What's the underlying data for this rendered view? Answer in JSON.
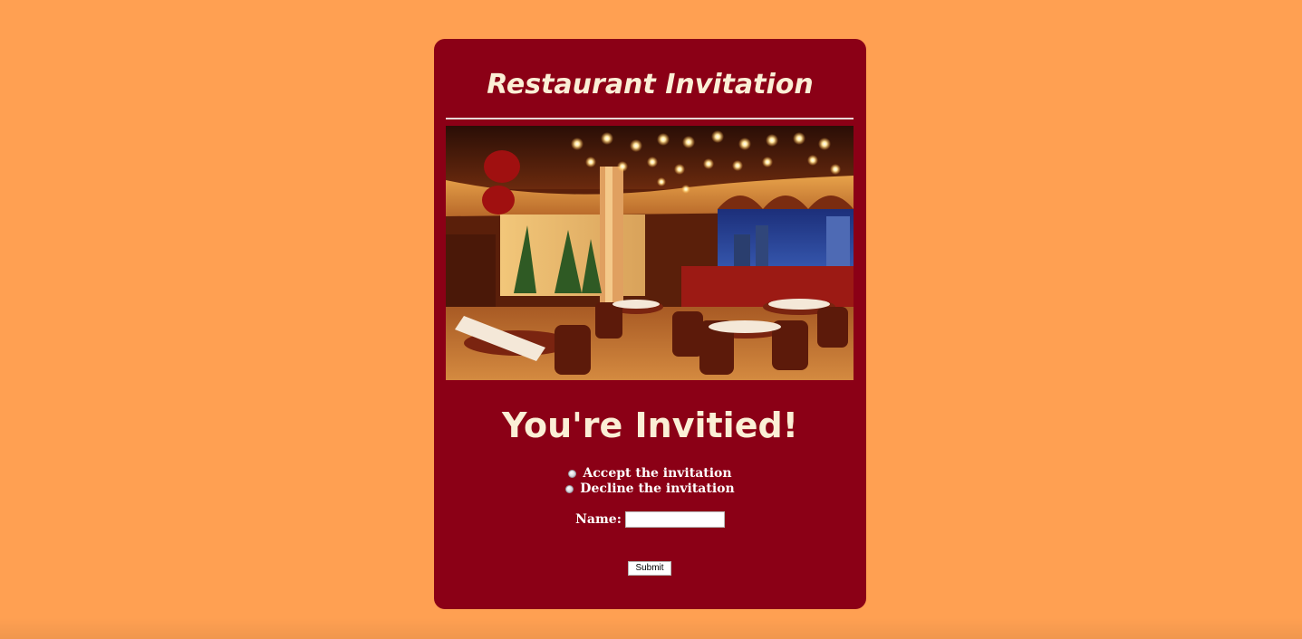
{
  "page": {
    "background_color": "#FFA052",
    "card_color": "#8B0016",
    "title_color": "#FBEFD6"
  },
  "invitation": {
    "title": "Restaurant Invitation",
    "headline": "You're Invitied!",
    "photo_alt": "restaurant-dining-room-photo"
  },
  "rsvp": {
    "options": [
      {
        "label": "Accept the invitation",
        "selected": false
      },
      {
        "label": "Decline the invitation",
        "selected": false
      }
    ],
    "name_label": "Name:",
    "name_value": "",
    "submit_label": "Submit"
  }
}
